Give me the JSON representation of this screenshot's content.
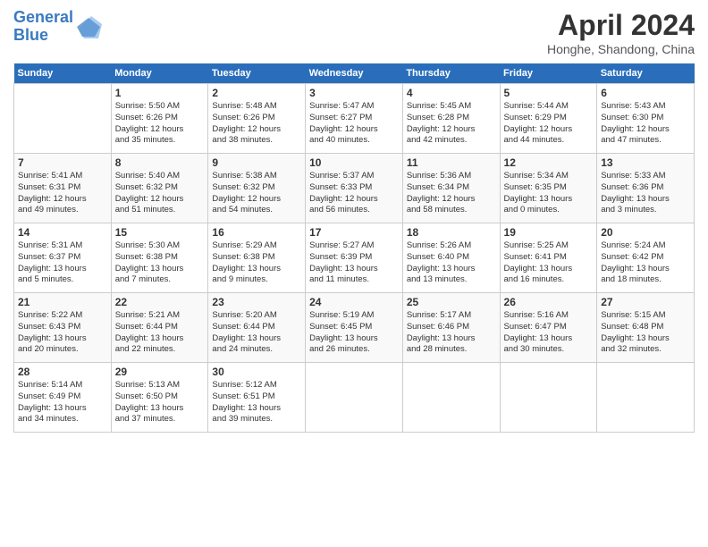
{
  "header": {
    "logo_line1": "General",
    "logo_line2": "Blue",
    "title": "April 2024",
    "subtitle": "Honghe, Shandong, China"
  },
  "weekdays": [
    "Sunday",
    "Monday",
    "Tuesday",
    "Wednesday",
    "Thursday",
    "Friday",
    "Saturday"
  ],
  "weeks": [
    [
      {
        "day": "",
        "info": ""
      },
      {
        "day": "1",
        "info": "Sunrise: 5:50 AM\nSunset: 6:26 PM\nDaylight: 12 hours\nand 35 minutes."
      },
      {
        "day": "2",
        "info": "Sunrise: 5:48 AM\nSunset: 6:26 PM\nDaylight: 12 hours\nand 38 minutes."
      },
      {
        "day": "3",
        "info": "Sunrise: 5:47 AM\nSunset: 6:27 PM\nDaylight: 12 hours\nand 40 minutes."
      },
      {
        "day": "4",
        "info": "Sunrise: 5:45 AM\nSunset: 6:28 PM\nDaylight: 12 hours\nand 42 minutes."
      },
      {
        "day": "5",
        "info": "Sunrise: 5:44 AM\nSunset: 6:29 PM\nDaylight: 12 hours\nand 44 minutes."
      },
      {
        "day": "6",
        "info": "Sunrise: 5:43 AM\nSunset: 6:30 PM\nDaylight: 12 hours\nand 47 minutes."
      }
    ],
    [
      {
        "day": "7",
        "info": "Sunrise: 5:41 AM\nSunset: 6:31 PM\nDaylight: 12 hours\nand 49 minutes."
      },
      {
        "day": "8",
        "info": "Sunrise: 5:40 AM\nSunset: 6:32 PM\nDaylight: 12 hours\nand 51 minutes."
      },
      {
        "day": "9",
        "info": "Sunrise: 5:38 AM\nSunset: 6:32 PM\nDaylight: 12 hours\nand 54 minutes."
      },
      {
        "day": "10",
        "info": "Sunrise: 5:37 AM\nSunset: 6:33 PM\nDaylight: 12 hours\nand 56 minutes."
      },
      {
        "day": "11",
        "info": "Sunrise: 5:36 AM\nSunset: 6:34 PM\nDaylight: 12 hours\nand 58 minutes."
      },
      {
        "day": "12",
        "info": "Sunrise: 5:34 AM\nSunset: 6:35 PM\nDaylight: 13 hours\nand 0 minutes."
      },
      {
        "day": "13",
        "info": "Sunrise: 5:33 AM\nSunset: 6:36 PM\nDaylight: 13 hours\nand 3 minutes."
      }
    ],
    [
      {
        "day": "14",
        "info": "Sunrise: 5:31 AM\nSunset: 6:37 PM\nDaylight: 13 hours\nand 5 minutes."
      },
      {
        "day": "15",
        "info": "Sunrise: 5:30 AM\nSunset: 6:38 PM\nDaylight: 13 hours\nand 7 minutes."
      },
      {
        "day": "16",
        "info": "Sunrise: 5:29 AM\nSunset: 6:38 PM\nDaylight: 13 hours\nand 9 minutes."
      },
      {
        "day": "17",
        "info": "Sunrise: 5:27 AM\nSunset: 6:39 PM\nDaylight: 13 hours\nand 11 minutes."
      },
      {
        "day": "18",
        "info": "Sunrise: 5:26 AM\nSunset: 6:40 PM\nDaylight: 13 hours\nand 13 minutes."
      },
      {
        "day": "19",
        "info": "Sunrise: 5:25 AM\nSunset: 6:41 PM\nDaylight: 13 hours\nand 16 minutes."
      },
      {
        "day": "20",
        "info": "Sunrise: 5:24 AM\nSunset: 6:42 PM\nDaylight: 13 hours\nand 18 minutes."
      }
    ],
    [
      {
        "day": "21",
        "info": "Sunrise: 5:22 AM\nSunset: 6:43 PM\nDaylight: 13 hours\nand 20 minutes."
      },
      {
        "day": "22",
        "info": "Sunrise: 5:21 AM\nSunset: 6:44 PM\nDaylight: 13 hours\nand 22 minutes."
      },
      {
        "day": "23",
        "info": "Sunrise: 5:20 AM\nSunset: 6:44 PM\nDaylight: 13 hours\nand 24 minutes."
      },
      {
        "day": "24",
        "info": "Sunrise: 5:19 AM\nSunset: 6:45 PM\nDaylight: 13 hours\nand 26 minutes."
      },
      {
        "day": "25",
        "info": "Sunrise: 5:17 AM\nSunset: 6:46 PM\nDaylight: 13 hours\nand 28 minutes."
      },
      {
        "day": "26",
        "info": "Sunrise: 5:16 AM\nSunset: 6:47 PM\nDaylight: 13 hours\nand 30 minutes."
      },
      {
        "day": "27",
        "info": "Sunrise: 5:15 AM\nSunset: 6:48 PM\nDaylight: 13 hours\nand 32 minutes."
      }
    ],
    [
      {
        "day": "28",
        "info": "Sunrise: 5:14 AM\nSunset: 6:49 PM\nDaylight: 13 hours\nand 34 minutes."
      },
      {
        "day": "29",
        "info": "Sunrise: 5:13 AM\nSunset: 6:50 PM\nDaylight: 13 hours\nand 37 minutes."
      },
      {
        "day": "30",
        "info": "Sunrise: 5:12 AM\nSunset: 6:51 PM\nDaylight: 13 hours\nand 39 minutes."
      },
      {
        "day": "",
        "info": ""
      },
      {
        "day": "",
        "info": ""
      },
      {
        "day": "",
        "info": ""
      },
      {
        "day": "",
        "info": ""
      }
    ]
  ]
}
